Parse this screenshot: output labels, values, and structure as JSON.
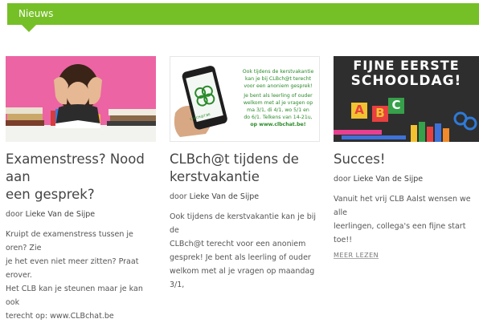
{
  "section": {
    "title": "Nieuws"
  },
  "byline_prefix": "door",
  "articles": [
    {
      "title_line1": "Examenstress? Nood aan",
      "title_line2": "een gesprek?",
      "author": "Lieke Van de Sijpe",
      "excerpt_lines": [
        "Kruipt de examenstress tussen je oren? Zie",
        "je het even niet meer zitten? Praat erover.",
        "Het CLB kan je steunen maar je kan ook",
        "terecht op: www.CLBchat.be"
      ],
      "image": "stressed-student-with-books"
    },
    {
      "title_line1": "CLBch@t tijdens de",
      "title_line2": "kerstvakantie",
      "author": "Lieke Van de Sijpe",
      "excerpt_lines": [
        "Ook tijdens de kerstvakantie kan je bij de",
        "CLBch@t terecht voor een anoniem",
        "gesprek! Je bent als leerling of ouder",
        "welkom met al je vragen op maandag 3/1,"
      ],
      "image": "phone-with-clbchat",
      "flyer_lines": [
        "Ook tijdens de kerstvakantie",
        "kan je bij CLBch@t terecht",
        "voor een anoniem gesprek!",
        "Je bent als leerling of ouder",
        "welkom met al je vragen op",
        "ma 3/1, di 4/1, wo 5/1 en",
        "do 6/1. Telkens van 14-21u,",
        "op www.clbchat.be!"
      ],
      "phone_logo": "CLBCH@T.BE"
    },
    {
      "title_line1": "Succes!",
      "author": "Lieke Van de Sijpe",
      "excerpt_lines": [
        "Vanuit het vrij CLB Aalst wensen we alle",
        "leerlingen, collega's een fijne start toe!!"
      ],
      "more_label": "MEER LEZEN",
      "image": "first-school-day-chalkboard",
      "image_headline_line1": "FIJNE EERSTE",
      "image_headline_line2": "SCHOOLDAG!",
      "letters": [
        "A",
        "B",
        "C"
      ]
    }
  ],
  "colors": {
    "accent": "#76c027",
    "text": "#444444",
    "chat_green": "#2a8a2a"
  }
}
